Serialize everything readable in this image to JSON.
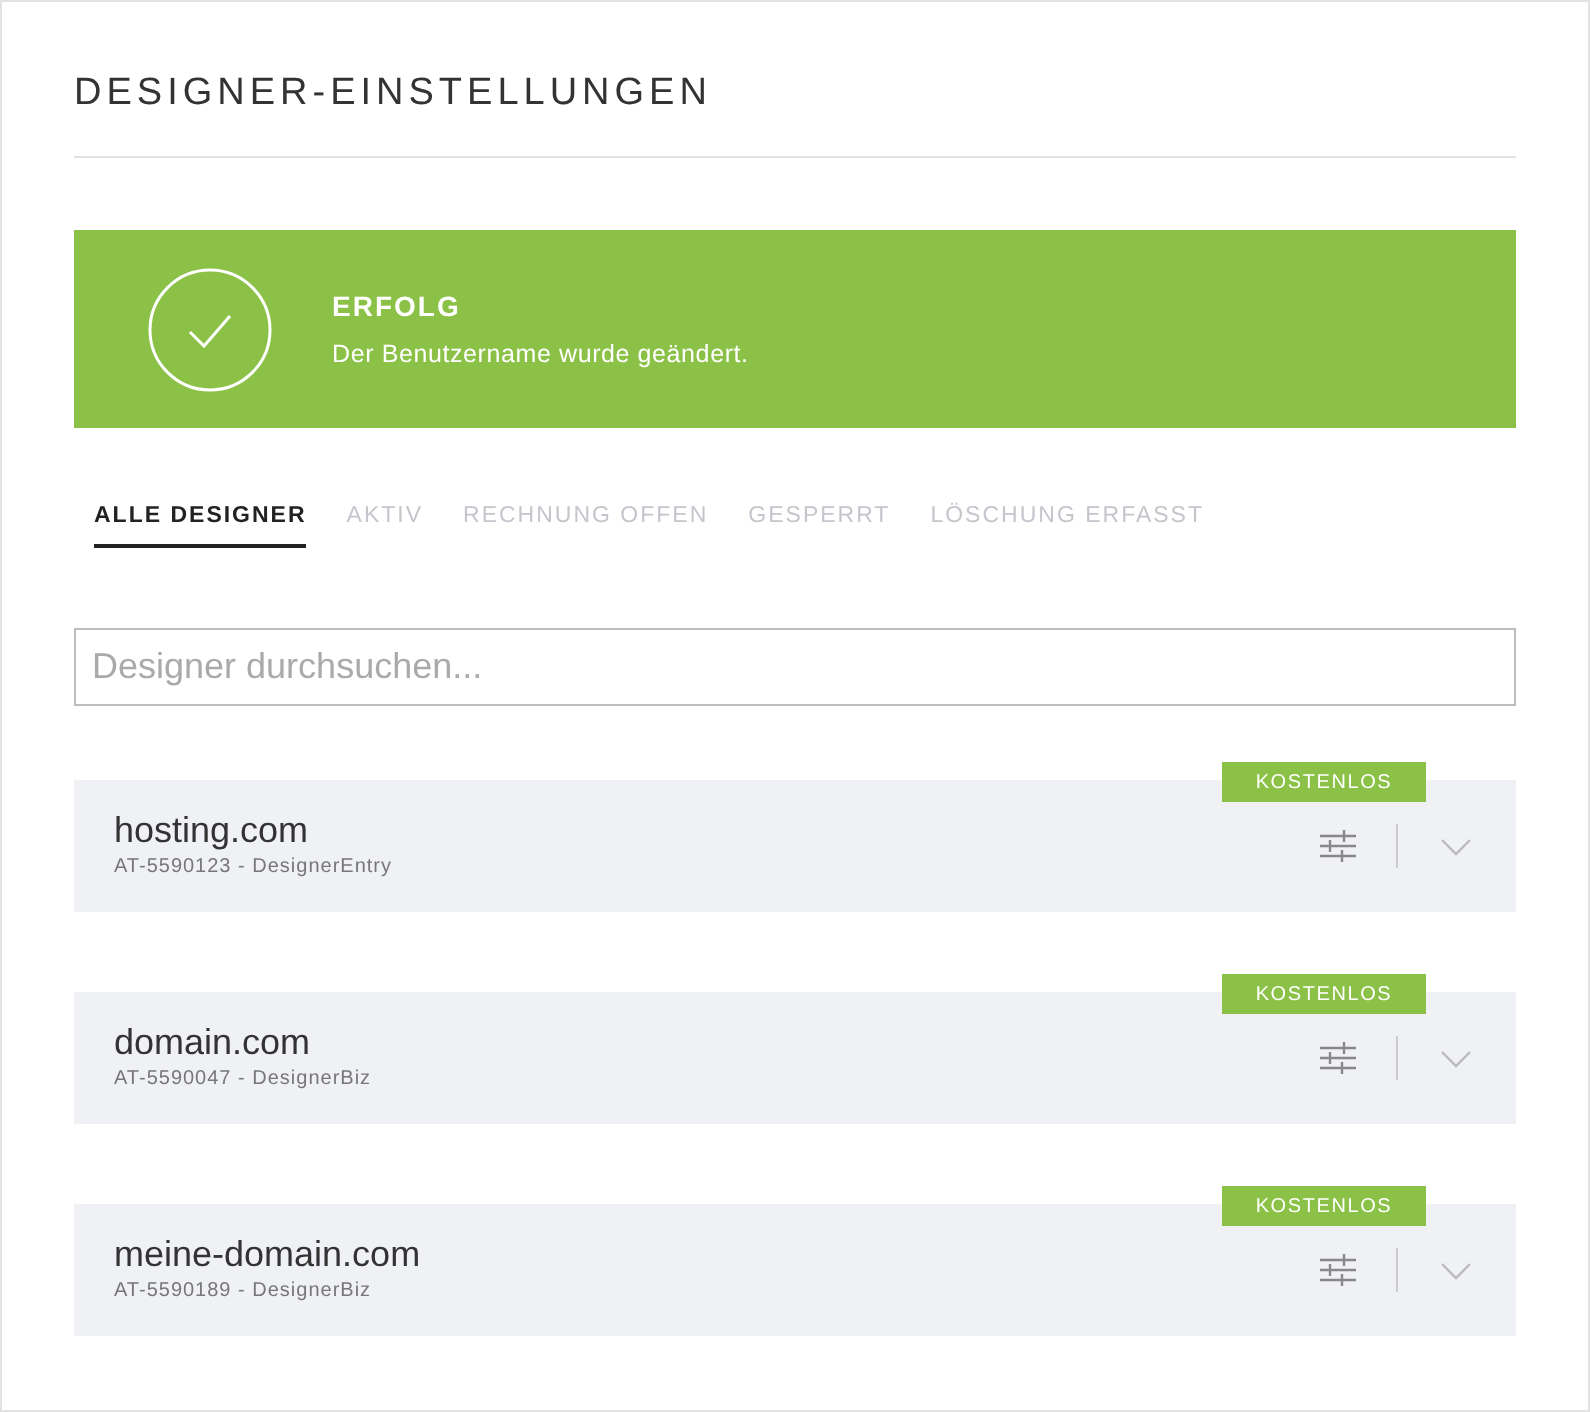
{
  "title": "DESIGNER-EINSTELLUNGEN",
  "alert": {
    "heading": "ERFOLG",
    "message": "Der Benutzername wurde geändert."
  },
  "tabs": [
    {
      "label": "ALLE DESIGNER",
      "selected": true
    },
    {
      "label": "AKTIV",
      "selected": false
    },
    {
      "label": "RECHNUNG OFFEN",
      "selected": false
    },
    {
      "label": "GESPERRT",
      "selected": false
    },
    {
      "label": "LÖSCHUNG ERFASST",
      "selected": false
    }
  ],
  "search": {
    "placeholder": "Designer durchsuchen..."
  },
  "designers": [
    {
      "domain": "hosting.com",
      "details": "AT-5590123 - DesignerEntry",
      "badge": "KOSTENLOS"
    },
    {
      "domain": "domain.com",
      "details": "AT-5590047 - DesignerBiz",
      "badge": "KOSTENLOS"
    },
    {
      "domain": "meine-domain.com",
      "details": "AT-5590189 - DesignerBiz",
      "badge": "KOSTENLOS"
    }
  ]
}
